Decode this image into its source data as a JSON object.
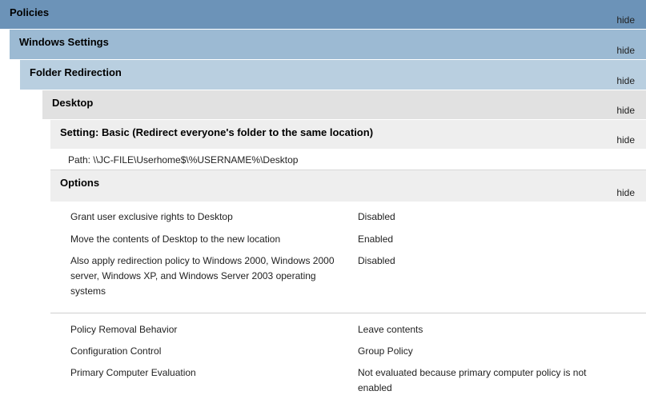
{
  "sections": {
    "policies": {
      "title": "Policies",
      "hide": "hide"
    },
    "windows_settings": {
      "title": "Windows Settings",
      "hide": "hide"
    },
    "folder_redirection": {
      "title": "Folder Redirection",
      "hide": "hide"
    },
    "desktop": {
      "title": "Desktop",
      "hide": "hide"
    },
    "setting": {
      "title": "Setting: Basic (Redirect everyone's folder to the same location)",
      "hide": "hide"
    },
    "options": {
      "title": "Options",
      "hide": "hide"
    }
  },
  "path": "Path: \\\\JC-FILE\\Userhome$\\%USERNAME%\\Desktop",
  "options_rows": [
    {
      "label": "Grant user exclusive rights to Desktop",
      "value": "Disabled"
    },
    {
      "label": "Move the contents of Desktop to the new location",
      "value": "Enabled"
    },
    {
      "label": "Also apply redirection policy to Windows 2000, Windows 2000 server, Windows XP, and Windows Server 2003 operating systems",
      "value": "Disabled"
    }
  ],
  "behavior_rows": [
    {
      "label": "Policy Removal Behavior",
      "value": "Leave contents"
    },
    {
      "label": "Configuration Control",
      "value": "Group Policy"
    },
    {
      "label": "Primary Computer Evaluation",
      "value": "Not evaluated because primary computer policy is not enabled"
    }
  ]
}
